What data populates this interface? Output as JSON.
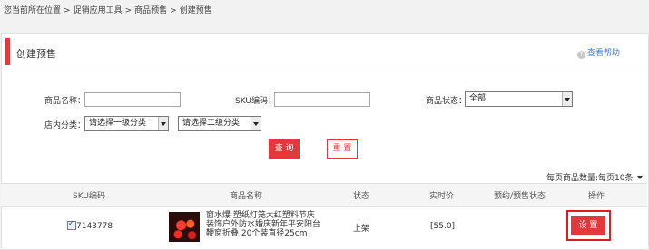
{
  "breadcrumb": {
    "items": [
      "您当前所在位置",
      "促销应用工具",
      "商品预售",
      "创建预售"
    ],
    "separator": ">"
  },
  "header": {
    "title": "创建预售",
    "help": "查看帮助"
  },
  "filters": {
    "product_name_label": "商品名称：",
    "product_name_value": "",
    "sku_label": "SKU编码：",
    "sku_value": "",
    "status_label": "商品状态：",
    "status_value": "全部",
    "category_label": "店内分类：",
    "category1_value": "请选择一级分类",
    "category2_value": "请选择二级分类"
  },
  "buttons": {
    "search": "查 询",
    "reset": "重 置"
  },
  "page_size": {
    "label": "每页商品数量:",
    "value": "每页10条"
  },
  "table": {
    "headers": [
      "SKU编码",
      "商品名称",
      "状态",
      "实时价",
      "预约/预售状态",
      "操作"
    ],
    "rows": [
      {
        "sku": "7143778",
        "checked": true,
        "name": "窗水爆 塑纸灯笼大红塑料节庆装饰户外防水婚庆新年平安阳台鞭窗折叠 20个装直径25cm",
        "status": "上架",
        "price": "[55.0]",
        "presale_status": "",
        "action": "设 置"
      }
    ]
  },
  "colors": {
    "accent": "#e4393c",
    "link": "#3a7bd5"
  }
}
